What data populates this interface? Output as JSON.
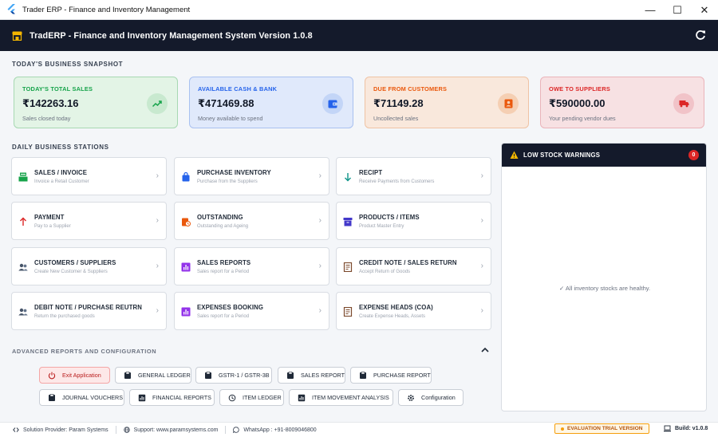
{
  "window": {
    "title": "Trader ERP - Finance and Inventory Management"
  },
  "appbar": {
    "title": "TradERP - Finance and Inventory Management System Version 1.0.8"
  },
  "snapshot": {
    "heading": "TODAY'S BUSINESS SNAPSHOT",
    "cards": [
      {
        "label": "TODAY'S TOTAL SALES",
        "value": "₹142263.16",
        "sub": "Sales closed today",
        "icon": "trending-up-icon",
        "accent": "#16a34a"
      },
      {
        "label": "AVAILABLE CASH & BANK",
        "value": "₹471469.88",
        "sub": "Money available to spend",
        "icon": "wallet-icon",
        "accent": "#2563eb"
      },
      {
        "label": "DUE FROM CUSTOMERS",
        "value": "₹71149.28",
        "sub": "Uncollected sales",
        "icon": "customer-badge-icon",
        "accent": "#ea580c"
      },
      {
        "label": "OWE TO SUPPLIERS",
        "value": "₹590000.00",
        "sub": "Your pending vendor dues",
        "icon": "truck-icon",
        "accent": "#dc2626"
      }
    ]
  },
  "stations": {
    "heading": "DAILY BUSINESS STATIONS",
    "tiles": [
      {
        "title": "SALES / INVOICE",
        "sub": "Invoice a Retail Customer",
        "icon": "cash-register-icon"
      },
      {
        "title": "PURCHASE INVENTORY",
        "sub": "Purchase from the Suppliers",
        "icon": "shopping-bag-icon"
      },
      {
        "title": "RECIPT",
        "sub": "Receive Payments from Customers",
        "icon": "arrow-down-icon"
      },
      {
        "title": "PAYMENT",
        "sub": "Pay to a Supplier",
        "icon": "arrow-up-icon"
      },
      {
        "title": "OUTSTANDING",
        "sub": "Outstanding and Ageing",
        "icon": "clipboard-clock-icon"
      },
      {
        "title": "PRODUCTS / ITEMS",
        "sub": "Product Master Entry",
        "icon": "inventory-box-icon"
      },
      {
        "title": "CUSTOMERS / SUPPLIERS",
        "sub": "Create New Customer & Suppliers",
        "icon": "people-icon"
      },
      {
        "title": "SALES REPORTS",
        "sub": "Sales report for a Period",
        "icon": "bar-chart-icon"
      },
      {
        "title": "CREDIT NOTE / SALES RETURN",
        "sub": "Accept Return of Goods",
        "icon": "receipt-icon"
      },
      {
        "title": "DEBIT NOTE / PURCHASE REUTRN",
        "sub": "Return the purchased goods",
        "icon": "people-icon"
      },
      {
        "title": "EXPENSES BOOKING",
        "sub": "Sales report for a Period",
        "icon": "bar-chart-icon"
      },
      {
        "title": "EXPENSE HEADS (COA)",
        "sub": "Create Expense Heads, Assets",
        "icon": "receipt-icon"
      }
    ]
  },
  "advanced": {
    "heading": "ADVANCED REPORTS AND CONFIGURATION",
    "buttons": [
      {
        "label": "Exit Application",
        "icon": "power-icon"
      },
      {
        "label": "GENERAL LEDGER",
        "icon": "file-icon"
      },
      {
        "label": "GSTR-1 / GSTR-3B",
        "icon": "file-icon"
      },
      {
        "label": "SALES REPORT",
        "icon": "file-icon"
      },
      {
        "label": "PURCHASE REPORT",
        "icon": "file-icon"
      },
      {
        "label": "JOURNAL VOUCHERS",
        "icon": "file-icon"
      },
      {
        "label": "FINANCIAL REPORTS",
        "icon": "report-icon"
      },
      {
        "label": "ITEM LEDGER",
        "icon": "history-icon"
      },
      {
        "label": "ITEM MOVEMENT ANALYSIS",
        "icon": "report-icon"
      },
      {
        "label": "Configuration",
        "icon": "gear-icon"
      }
    ]
  },
  "stock": {
    "title": "LOW STOCK WARNINGS",
    "count": "0",
    "message": "✓ All inventory stocks are healthy."
  },
  "status": {
    "provider": "Solution Provider: Param Systems",
    "support": "Support: www.paramsystems.com",
    "whatsapp": "WhatsApp : +91-8009046800",
    "trial": "EVALUATION TRIAL VERSION",
    "build": "Build: v1.0.8"
  },
  "colors": {
    "header": "#141a2b",
    "danger": "#dc2626",
    "warning": "#f59e0b"
  }
}
